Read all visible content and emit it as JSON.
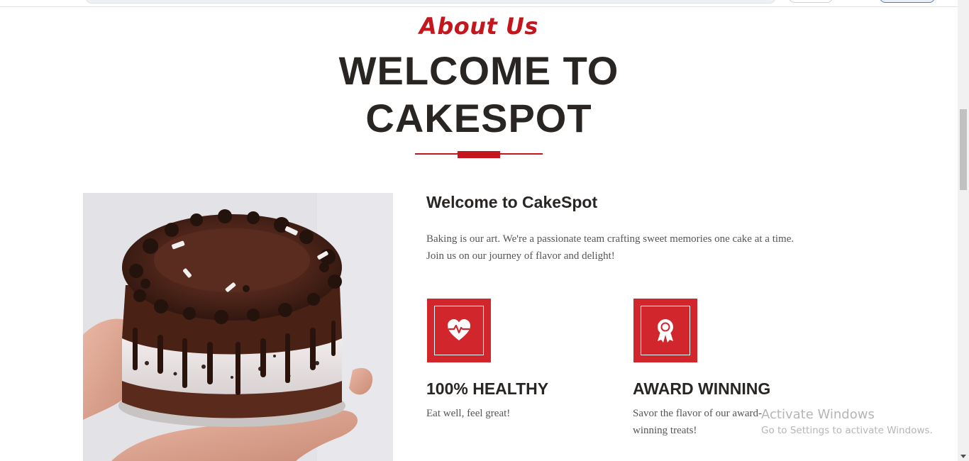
{
  "header": {
    "eyebrow": "About Us",
    "headline_line1": "WELCOME TO",
    "headline_line2": "CAKESPOT"
  },
  "about": {
    "title": "Welcome to CakeSpot",
    "text": "Baking is our art. We're a passionate team crafting sweet memories one cake at a time. Join us on our journey of flavor and delight!",
    "image_icon": "chocolate-cake-photo"
  },
  "features": [
    {
      "icon": "heart-pulse-icon",
      "title": "100% HEALTHY",
      "text": "Eat well, feel great!"
    },
    {
      "icon": "award-ribbon-icon",
      "title": "AWARD WINNING",
      "text": "Savor the flavor of our award-winning treats!"
    }
  ],
  "watermark": {
    "title": "Activate Windows",
    "subtitle": "Go to Settings to activate Windows."
  },
  "colors": {
    "accent": "#c4161c",
    "icon_bg": "#d1272c",
    "heading": "#282523",
    "body_text": "#555555"
  }
}
